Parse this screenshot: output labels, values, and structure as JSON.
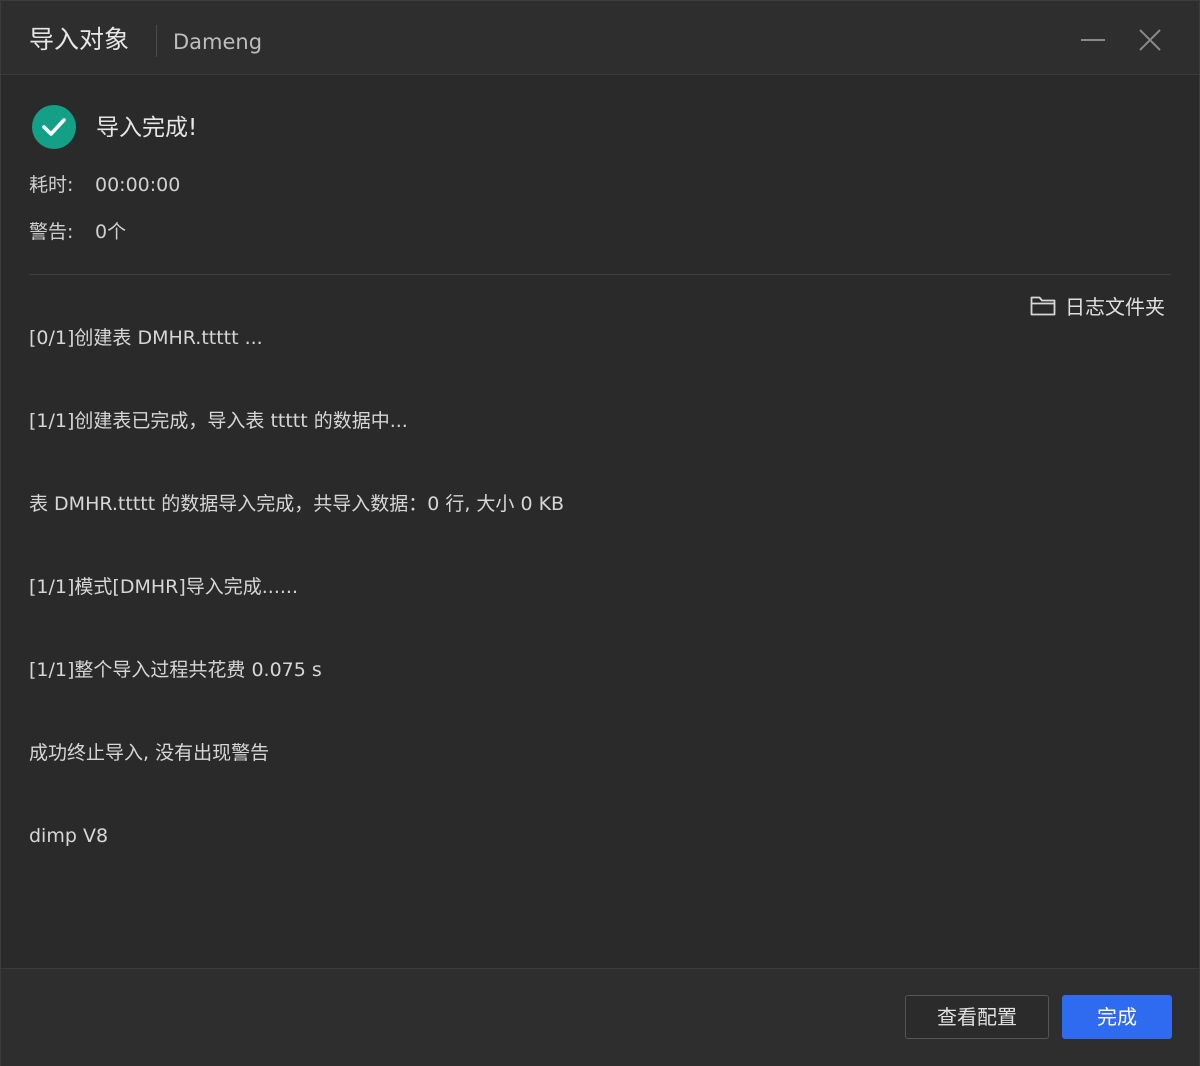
{
  "header": {
    "title": "导入对象",
    "subtitle": "Dameng"
  },
  "status": {
    "title": "导入完成!",
    "icon": "check-circle-icon",
    "icon_color": "#13a086"
  },
  "meta": {
    "time_label": "耗时:",
    "time_value": "00:00:00",
    "warn_label": "警告:",
    "warn_value": "0个"
  },
  "log_folder": {
    "label": "日志文件夹",
    "icon": "folder-icon"
  },
  "logs": [
    "[0/1]创建表 DMHR.ttttt ...",
    "[1/1]创建表已完成，导入表 ttttt 的数据中...",
    "表 DMHR.ttttt 的数据导入完成，共导入数据：0 行, 大小 0 KB",
    "[1/1]模式[DMHR]导入完成......",
    "[1/1]整个导入过程共花费 0.075 s",
    "成功终止导入, 没有出现警告",
    "dimp V8"
  ],
  "footer": {
    "config_label": "查看配置",
    "done_label": "完成",
    "primary_color": "#2f6bf0"
  }
}
